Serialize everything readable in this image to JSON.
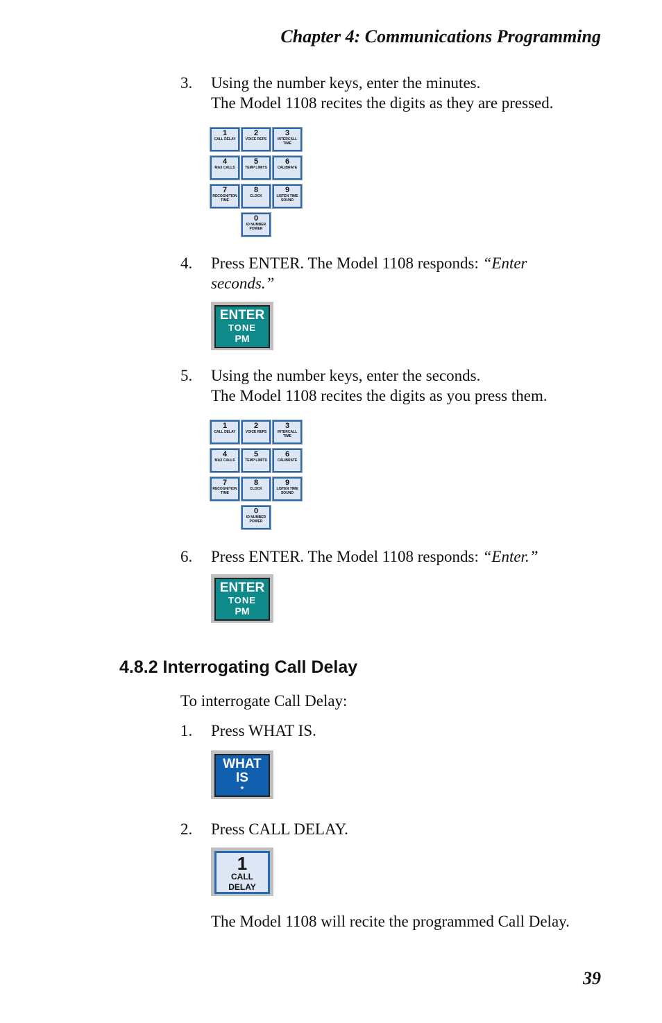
{
  "header": "Chapter  4:  Communications Programming",
  "page_number": "39",
  "steps_a": [
    {
      "num": "3.",
      "lines": [
        "Using the number keys, enter the minutes.",
        "The Model 1108 recites the digits as they are pressed."
      ]
    },
    {
      "num": "4.",
      "lines": [
        "Press ENTER. The Model 1108 responds: ",
        "“Enter",
        "seconds.”"
      ]
    },
    {
      "num": "5.",
      "lines": [
        "Using the number keys, enter the seconds.",
        "The Model 1108 recites the digits as you press them."
      ]
    },
    {
      "num": "6.",
      "lines": [
        "Press ENTER. The Model 1108 responds: ",
        "“Enter.”"
      ]
    }
  ],
  "keypad": [
    {
      "digit": "1",
      "label": "CALL DELAY"
    },
    {
      "digit": "2",
      "label": "VOICE REPS"
    },
    {
      "digit": "3",
      "label": "INTERCALL TIME"
    },
    {
      "digit": "4",
      "label": "MAX CALLS"
    },
    {
      "digit": "5",
      "label": "TEMP LIMITS"
    },
    {
      "digit": "6",
      "label": "CALIBRATE"
    },
    {
      "digit": "7",
      "label": "RECOGNITION TIME"
    },
    {
      "digit": "8",
      "label": "CLOCK"
    },
    {
      "digit": "9",
      "label": "LISTEN TIME SOUND"
    },
    {
      "digit": "0",
      "label": "ID NUMBER POWER"
    }
  ],
  "enter_key": {
    "line1": "ENTER",
    "line2": "TONE",
    "line3": "PM"
  },
  "section": {
    "heading": "4.8.2  Interrogating Call Delay",
    "intro": "To interrogate Call Delay:"
  },
  "steps_b": [
    {
      "num": "1.",
      "text": "Press WHAT IS."
    },
    {
      "num": "2.",
      "text": "Press CALL DELAY."
    }
  ],
  "what_key": {
    "line1": "WHAT",
    "line2": "IS",
    "line3": "*"
  },
  "call_delay_key": {
    "digit": "1",
    "line1": "CALL",
    "line2": "DELAY"
  },
  "closing": "The Model 1108 will recite the programmed Call Delay."
}
